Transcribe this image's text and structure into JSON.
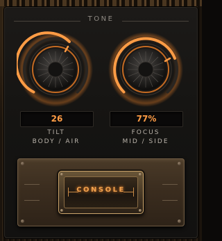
{
  "section": {
    "title": "TONE"
  },
  "knobs": [
    {
      "id": "tilt",
      "value_text": "26",
      "label": "TILT",
      "sublabel": "BODY / AIR",
      "level": 0.62
    },
    {
      "id": "focus",
      "value_text": "77%",
      "label": "FOCUS",
      "sublabel": "MID / SIDE",
      "level": 0.77
    }
  ],
  "console_button": {
    "label": "CONSOLE"
  },
  "colors": {
    "accent": "#ff9c45",
    "panel": "#161412",
    "label": "#b9b3aa",
    "brass": "#c9a36a"
  }
}
